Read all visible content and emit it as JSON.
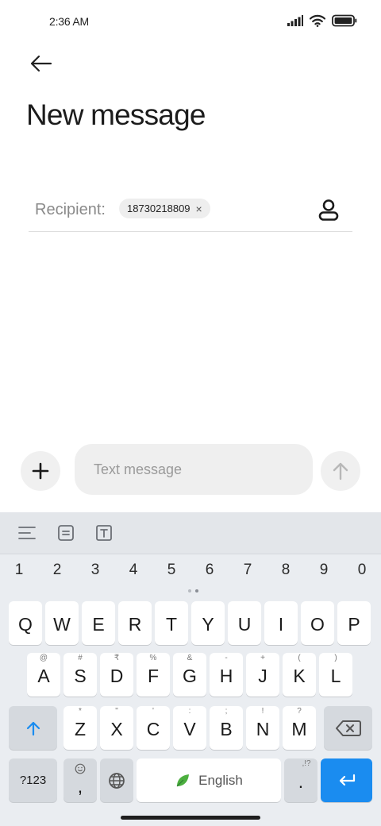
{
  "status_bar": {
    "time": "2:36 AM"
  },
  "header": {
    "title": "New message"
  },
  "recipient": {
    "label": "Recipient:",
    "chip": "18730218809",
    "chip_remove": "×"
  },
  "composer": {
    "placeholder": "Text message",
    "add": "+"
  },
  "keyboard": {
    "numbers": [
      "1",
      "2",
      "3",
      "4",
      "5",
      "6",
      "7",
      "8",
      "9",
      "0"
    ],
    "row1": [
      {
        "key": "Q",
        "hint": ""
      },
      {
        "key": "W",
        "hint": ""
      },
      {
        "key": "E",
        "hint": ""
      },
      {
        "key": "R",
        "hint": ""
      },
      {
        "key": "T",
        "hint": ""
      },
      {
        "key": "Y",
        "hint": ""
      },
      {
        "key": "U",
        "hint": ""
      },
      {
        "key": "I",
        "hint": ""
      },
      {
        "key": "O",
        "hint": ""
      },
      {
        "key": "P",
        "hint": ""
      }
    ],
    "row2": [
      {
        "key": "A",
        "hint": "@"
      },
      {
        "key": "S",
        "hint": "#"
      },
      {
        "key": "D",
        "hint": "₹"
      },
      {
        "key": "F",
        "hint": "%"
      },
      {
        "key": "G",
        "hint": "&"
      },
      {
        "key": "H",
        "hint": "-"
      },
      {
        "key": "J",
        "hint": "+"
      },
      {
        "key": "K",
        "hint": "("
      },
      {
        "key": "L",
        "hint": ")"
      }
    ],
    "row3": [
      {
        "key": "Z",
        "hint": "*"
      },
      {
        "key": "X",
        "hint": "\""
      },
      {
        "key": "C",
        "hint": "'"
      },
      {
        "key": "V",
        "hint": ":"
      },
      {
        "key": "B",
        "hint": ";"
      },
      {
        "key": "N",
        "hint": "!"
      },
      {
        "key": "M",
        "hint": "?"
      }
    ],
    "sym_label": "?123",
    "comma": ",",
    "space_label": "English",
    "period": ".",
    "period_hint": ",!?",
    "accent": "#1a8cf0"
  }
}
